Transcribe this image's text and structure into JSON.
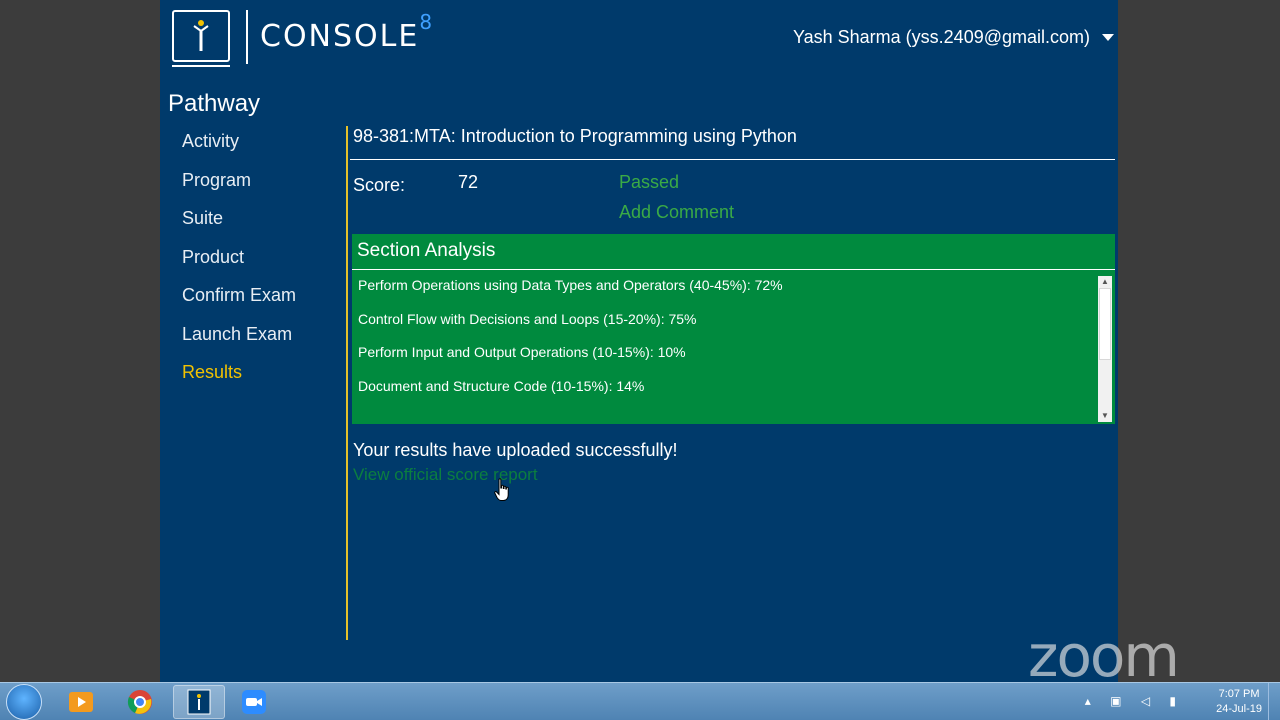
{
  "header": {
    "brand": "CONSOLE",
    "brand_sup": "8",
    "user": "Yash Sharma (yss.2409@gmail.com)"
  },
  "sidebar": {
    "title": "Pathway",
    "items": [
      {
        "label": "Activity"
      },
      {
        "label": "Program"
      },
      {
        "label": "Suite"
      },
      {
        "label": "Product"
      },
      {
        "label": "Confirm Exam"
      },
      {
        "label": "Launch Exam"
      },
      {
        "label": "Results",
        "active": true
      }
    ]
  },
  "main": {
    "course": "98-381:MTA: Introduction to Programming using Python",
    "score_label": "Score:",
    "score": "72",
    "status": "Passed",
    "add_comment": "Add Comment",
    "section_title": "Section Analysis",
    "sections": [
      {
        "text": "Perform Operations using Data Types and Operators (40-45%): 72%"
      },
      {
        "text": "Control Flow with Decisions and Loops (15-20%): 75%"
      },
      {
        "text": "Perform Input and Output Operations (10-15%): 10%"
      },
      {
        "text": "Document and Structure Code (10-15%): 14%"
      }
    ],
    "upload_message": "Your results have uploaded successfully!",
    "report_link": "View official score report"
  },
  "watermark": "zoom",
  "taskbar": {
    "time": "7:07 PM",
    "date": "24-Jul-19"
  },
  "colors": {
    "app_bg": "#003a6b",
    "accent_yellow": "#f2c200",
    "pass_green": "#3aaa46",
    "section_green": "#008a3e"
  }
}
